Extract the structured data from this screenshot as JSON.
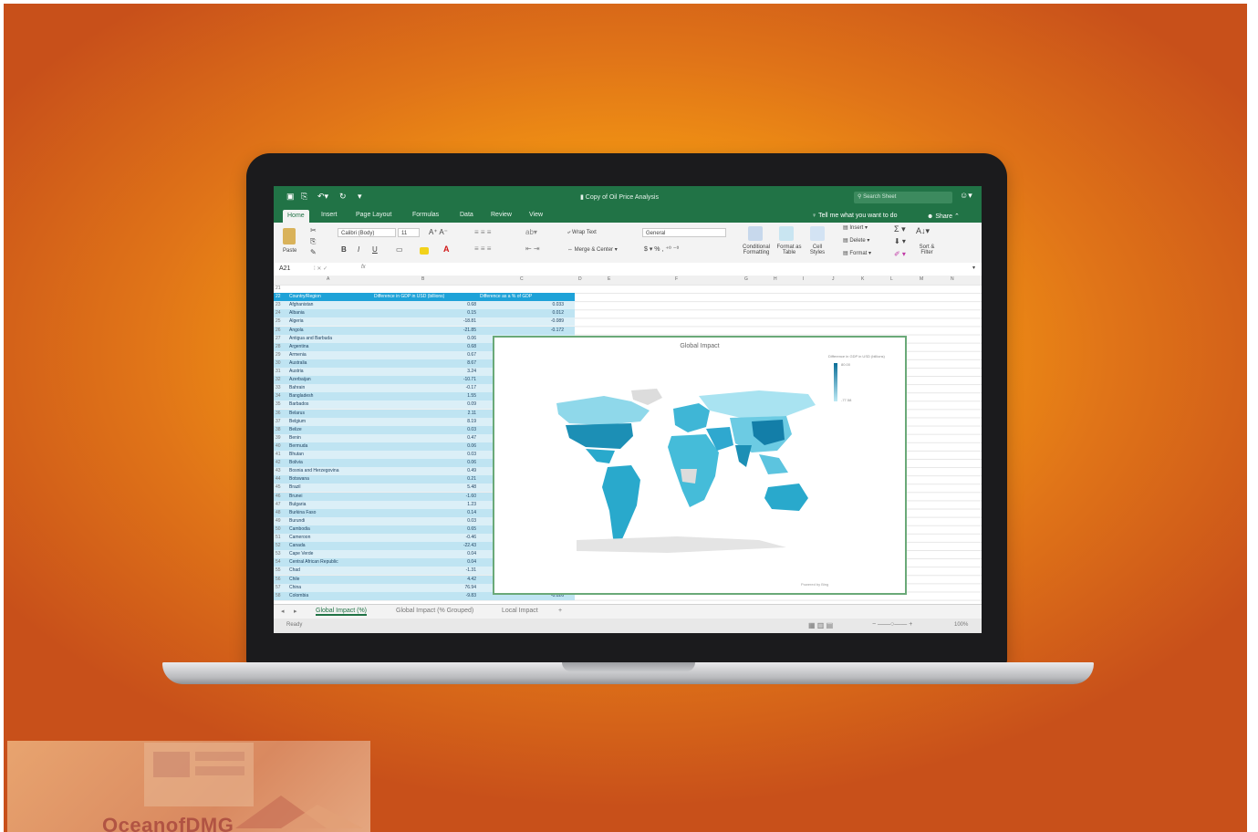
{
  "window": {
    "doc_title": "Copy of Oil Price Analysis",
    "search_placeholder": "Search Sheet"
  },
  "ribbon_tabs": [
    "Home",
    "Insert",
    "Page Layout",
    "Formulas",
    "Data",
    "Review",
    "View"
  ],
  "tell_me": "Tell me what you want to do",
  "share_label": "Share",
  "ribbon": {
    "paste": "Paste",
    "font_name": "Calibri (Body)",
    "font_size": "11",
    "wrap_text": "Wrap Text",
    "merge_center": "Merge & Center",
    "number_format": "General",
    "conditional_formatting": "Conditional Formatting",
    "format_as_table": "Format as Table",
    "cell_styles": "Cell Styles",
    "insert": "Insert",
    "delete": "Delete",
    "format": "Format",
    "sort_filter": "Sort & Filter"
  },
  "formula_bar": {
    "name_box": "A21",
    "fx": "fx"
  },
  "columns": [
    "A",
    "B",
    "C",
    "D",
    "E",
    "F",
    "G",
    "H",
    "I",
    "J",
    "K",
    "L",
    "M",
    "N"
  ],
  "table": {
    "headers": [
      "Country/Region",
      "Difference in GDP in USD (billions)",
      "Difference as a % of GDP"
    ],
    "rows": [
      {
        "n": "21",
        "name": "",
        "val": "",
        "pct": ""
      },
      {
        "n": "23",
        "name": "Afghanistan",
        "val": "0.68",
        "pct": "0.033"
      },
      {
        "n": "24",
        "name": "Albania",
        "val": "0.15",
        "pct": "0.012"
      },
      {
        "n": "25",
        "name": "Algeria",
        "val": "-18.81",
        "pct": "-0.089"
      },
      {
        "n": "26",
        "name": "Angola",
        "val": "-21.85",
        "pct": "-0.172"
      },
      {
        "n": "27",
        "name": "Antigua and Barbuda",
        "val": "0.06",
        "pct": ""
      },
      {
        "n": "28",
        "name": "Argentina",
        "val": "0.68",
        "pct": ""
      },
      {
        "n": "29",
        "name": "Armenia",
        "val": "0.67",
        "pct": ""
      },
      {
        "n": "30",
        "name": "Australia",
        "val": "8.67",
        "pct": ""
      },
      {
        "n": "31",
        "name": "Austria",
        "val": "3.24",
        "pct": ""
      },
      {
        "n": "32",
        "name": "Azerbaijan",
        "val": "-10.71",
        "pct": ""
      },
      {
        "n": "33",
        "name": "Bahrain",
        "val": "-0.17",
        "pct": ""
      },
      {
        "n": "34",
        "name": "Bangladesh",
        "val": "1.55",
        "pct": ""
      },
      {
        "n": "35",
        "name": "Barbados",
        "val": "0.09",
        "pct": ""
      },
      {
        "n": "36",
        "name": "Belarus",
        "val": "2.11",
        "pct": ""
      },
      {
        "n": "37",
        "name": "Belgium",
        "val": "8.19",
        "pct": ""
      },
      {
        "n": "38",
        "name": "Belize",
        "val": "0.03",
        "pct": ""
      },
      {
        "n": "39",
        "name": "Benin",
        "val": "0.47",
        "pct": ""
      },
      {
        "n": "40",
        "name": "Bermuda",
        "val": "0.06",
        "pct": ""
      },
      {
        "n": "41",
        "name": "Bhutan",
        "val": "0.03",
        "pct": ""
      },
      {
        "n": "42",
        "name": "Bolivia",
        "val": "0.06",
        "pct": ""
      },
      {
        "n": "43",
        "name": "Bosnia and Herzegovina",
        "val": "0.49",
        "pct": ""
      },
      {
        "n": "44",
        "name": "Botswana",
        "val": "0.21",
        "pct": ""
      },
      {
        "n": "45",
        "name": "Brazil",
        "val": "5.48",
        "pct": ""
      },
      {
        "n": "46",
        "name": "Brunei",
        "val": "-1.60",
        "pct": ""
      },
      {
        "n": "47",
        "name": "Bulgaria",
        "val": "1.23",
        "pct": ""
      },
      {
        "n": "48",
        "name": "Burkina Faso",
        "val": "0.14",
        "pct": ""
      },
      {
        "n": "49",
        "name": "Burundi",
        "val": "0.03",
        "pct": ""
      },
      {
        "n": "50",
        "name": "Cambodia",
        "val": "0.65",
        "pct": ""
      },
      {
        "n": "51",
        "name": "Cameroon",
        "val": "-0.46",
        "pct": ""
      },
      {
        "n": "52",
        "name": "Canada",
        "val": "-22.43",
        "pct": ""
      },
      {
        "n": "53",
        "name": "Cape Verde",
        "val": "0.04",
        "pct": ""
      },
      {
        "n": "54",
        "name": "Central African Republic",
        "val": "0.04",
        "pct": ""
      },
      {
        "n": "55",
        "name": "Chad",
        "val": "-1.31",
        "pct": ""
      },
      {
        "n": "56",
        "name": "Chile",
        "val": "4.42",
        "pct": ""
      },
      {
        "n": "57",
        "name": "China",
        "val": "76.94",
        "pct": ""
      },
      {
        "n": "58",
        "name": "Colombia",
        "val": "-9.83",
        "pct": "-0.026"
      }
    ]
  },
  "chart": {
    "title": "Global Impact",
    "legend_title": "Difference in GDP in USD (billions)",
    "legend_max": "80.00",
    "legend_min": "-77.58",
    "powered_by": "Powered by Bing"
  },
  "sheet_tabs": [
    "Global Impact (%)",
    "Global Impact (% Grouped)",
    "Local Impact"
  ],
  "status": {
    "ready": "Ready",
    "zoom": "100%"
  },
  "watermark": "OceanofDMG",
  "colors": {
    "excel_green": "#217346",
    "table_header": "#1ea2d8",
    "map_dark": "#1c8fb5",
    "map_light": "#8fd8ea"
  }
}
